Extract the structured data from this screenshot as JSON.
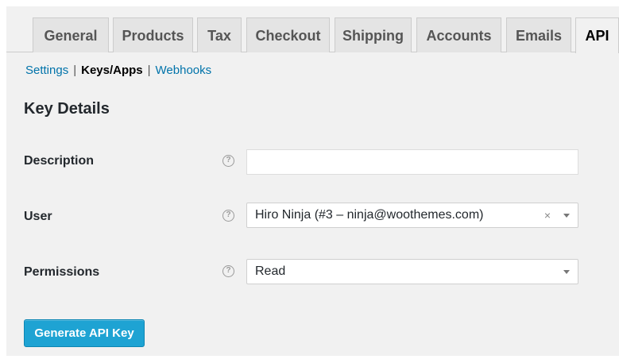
{
  "tabs": [
    {
      "label": "General"
    },
    {
      "label": "Products"
    },
    {
      "label": "Tax"
    },
    {
      "label": "Checkout"
    },
    {
      "label": "Shipping"
    },
    {
      "label": "Accounts"
    },
    {
      "label": "Emails"
    },
    {
      "label": "API",
      "active": true
    }
  ],
  "subnav": {
    "settings": "Settings",
    "separator": "|",
    "keys_apps": "Keys/Apps",
    "webhooks": "Webhooks"
  },
  "section_title": "Key Details",
  "form": {
    "description": {
      "label": "Description",
      "value": "",
      "help": "?"
    },
    "user": {
      "label": "User",
      "value": "Hiro Ninja (#3 – ninja@woothemes.com)",
      "clear": "×",
      "help": "?"
    },
    "permissions": {
      "label": "Permissions",
      "value": "Read",
      "help": "?"
    }
  },
  "generate_button": "Generate API Key",
  "colors": {
    "accent": "#1ea3d3",
    "link": "#0073aa",
    "background": "#f1f1f1"
  }
}
